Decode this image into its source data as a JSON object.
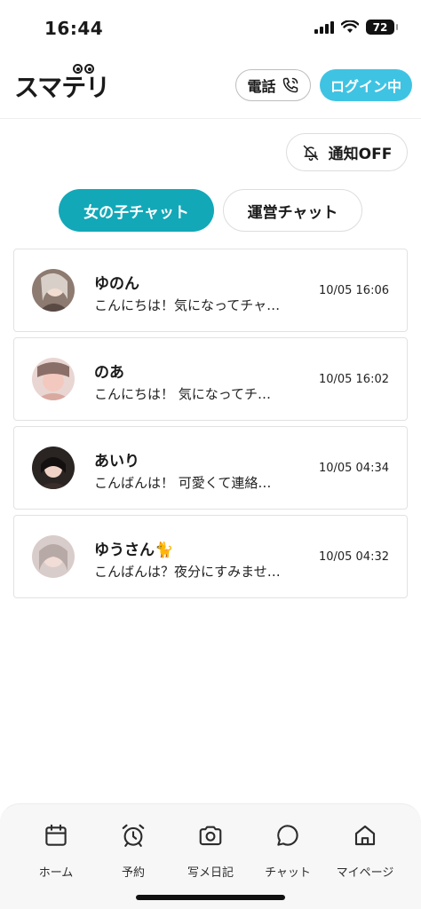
{
  "status_bar": {
    "time": "16:44",
    "battery": "72"
  },
  "header": {
    "logo_text": "スマテリ",
    "phone_label": "電話",
    "login_label": "ログイン中"
  },
  "notify": {
    "label": "通知OFF"
  },
  "tabs": [
    {
      "label": "女の子チャット",
      "active": true
    },
    {
      "label": "運営チャット",
      "active": false
    }
  ],
  "chats": [
    {
      "name": "ゆのん",
      "message": "こんにちは！気になってチャ…",
      "time": "10/05 16:06"
    },
    {
      "name": "のあ",
      "message": "こんにちは！ 気になってチ…",
      "time": "10/05 16:02"
    },
    {
      "name": "あいり",
      "message": "こんばんは！ 可愛くて連絡…",
      "time": "10/05 04:34"
    },
    {
      "name": "ゆうさん🐈",
      "message": "こんばんは？夜分にすみませ…",
      "time": "10/05 04:32"
    }
  ],
  "bottom_nav": [
    {
      "label": "ホーム",
      "icon": "calendar-icon"
    },
    {
      "label": "予約",
      "icon": "alarm-clock-icon"
    },
    {
      "label": "写メ日記",
      "icon": "camera-icon"
    },
    {
      "label": "チャット",
      "icon": "chat-bubble-icon"
    },
    {
      "label": "マイページ",
      "icon": "house-icon"
    }
  ],
  "colors": {
    "accent_teal": "#12a8b8",
    "login_blue": "#3fc3e3"
  }
}
